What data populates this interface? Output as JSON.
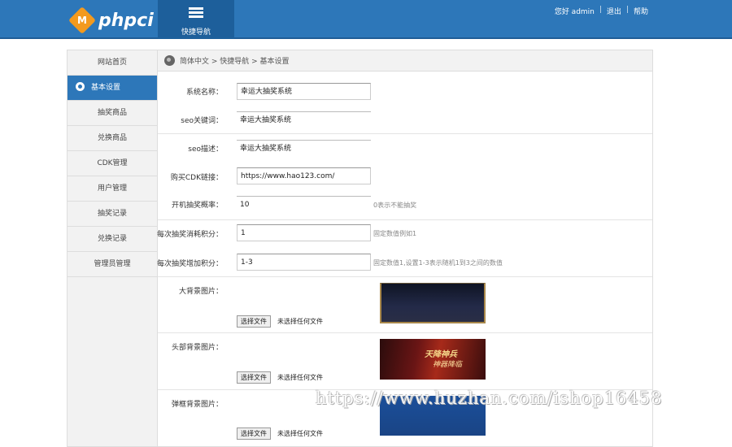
{
  "header": {
    "logo_letter": "M",
    "logo_text": "phpci",
    "quicknav_label": "快捷导航",
    "greeting": "您好 admin",
    "logout": "退出",
    "help": "帮助",
    "colors": {
      "bar": "#2d77b9",
      "quicknav": "#1d5f9b",
      "logo": "#f39a1e"
    }
  },
  "sidebar": {
    "items": [
      {
        "label": "网站首页"
      },
      {
        "label": "基本设置",
        "active": true,
        "icon": "gear-icon"
      },
      {
        "label": "抽奖商品"
      },
      {
        "label": "兑换商品"
      },
      {
        "label": "CDK管理"
      },
      {
        "label": "用户管理"
      },
      {
        "label": "抽奖记录"
      },
      {
        "label": "兑换记录"
      },
      {
        "label": "管理员管理"
      }
    ]
  },
  "breadcrumb": {
    "text": "简体中文 > 快捷导航 > 基本设置",
    "icon": "globe-icon"
  },
  "form": {
    "site_name": {
      "label": "系统名称：",
      "value": "幸运大抽奖系统"
    },
    "seo_keywords": {
      "label": "seo关键词：",
      "value": "幸运大抽奖系统"
    },
    "seo_desc": {
      "label": "seo描述：",
      "value": "幸运大抽奖系统"
    },
    "cdk_link": {
      "label": "购买CDK链接：",
      "value": "https://www.hao123.com/"
    },
    "count": {
      "label": "开机抽奖概率：",
      "value": "10",
      "hint": "0表示不能抽奖"
    },
    "per_draw": {
      "label": "每次抽奖消耗积分：",
      "value": "1",
      "hint": "固定数值例如1"
    },
    "per_point": {
      "label": "每次抽奖增加积分：",
      "value": "1-3",
      "hint": "固定数值1,设置1-3表示随机1到3之间的数值"
    },
    "bg_image": {
      "label": "大背景图片：",
      "button": "选择文件",
      "status": "未选择任何文件"
    },
    "head_image": {
      "label": "头部背景图片：",
      "button": "选择文件",
      "status": "未选择任何文件",
      "banner_line1": "天降神兵",
      "banner_line2": "神器降临"
    },
    "popup_image": {
      "label": "弹框背景图片：",
      "button": "选择文件",
      "status": "未选择任何文件"
    }
  },
  "watermark": "https://www.huzhan.com/ishop16458"
}
